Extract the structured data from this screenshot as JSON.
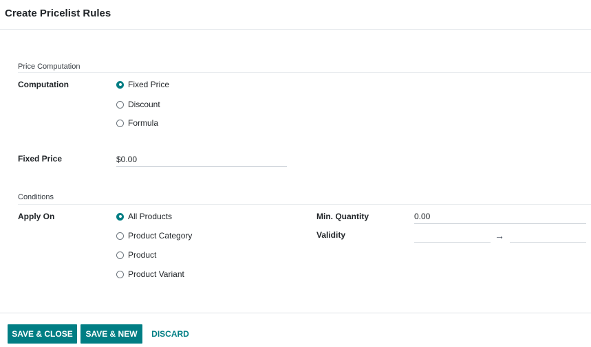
{
  "dialog": {
    "title": "Create Pricelist Rules"
  },
  "price_computation": {
    "section_label": "Price Computation",
    "computation_label": "Computation",
    "options": [
      "Fixed Price",
      "Discount",
      "Formula"
    ],
    "selected": "Fixed Price",
    "fixed_price_label": "Fixed Price",
    "fixed_price_value": "$0.00"
  },
  "conditions": {
    "section_label": "Conditions",
    "apply_on_label": "Apply On",
    "options": [
      "All Products",
      "Product Category",
      "Product",
      "Product Variant"
    ],
    "selected": "All Products",
    "min_quantity_label": "Min. Quantity",
    "min_quantity_value": "0.00",
    "validity_label": "Validity",
    "validity_start": "",
    "validity_end": "",
    "arrow_icon": "long-arrow-right-icon"
  },
  "footer": {
    "save_close_label": "SAVE & CLOSE",
    "save_new_label": "SAVE & NEW",
    "discard_label": "DISCARD"
  },
  "colors": {
    "accent": "#017e84",
    "border": "#dee2e6"
  }
}
